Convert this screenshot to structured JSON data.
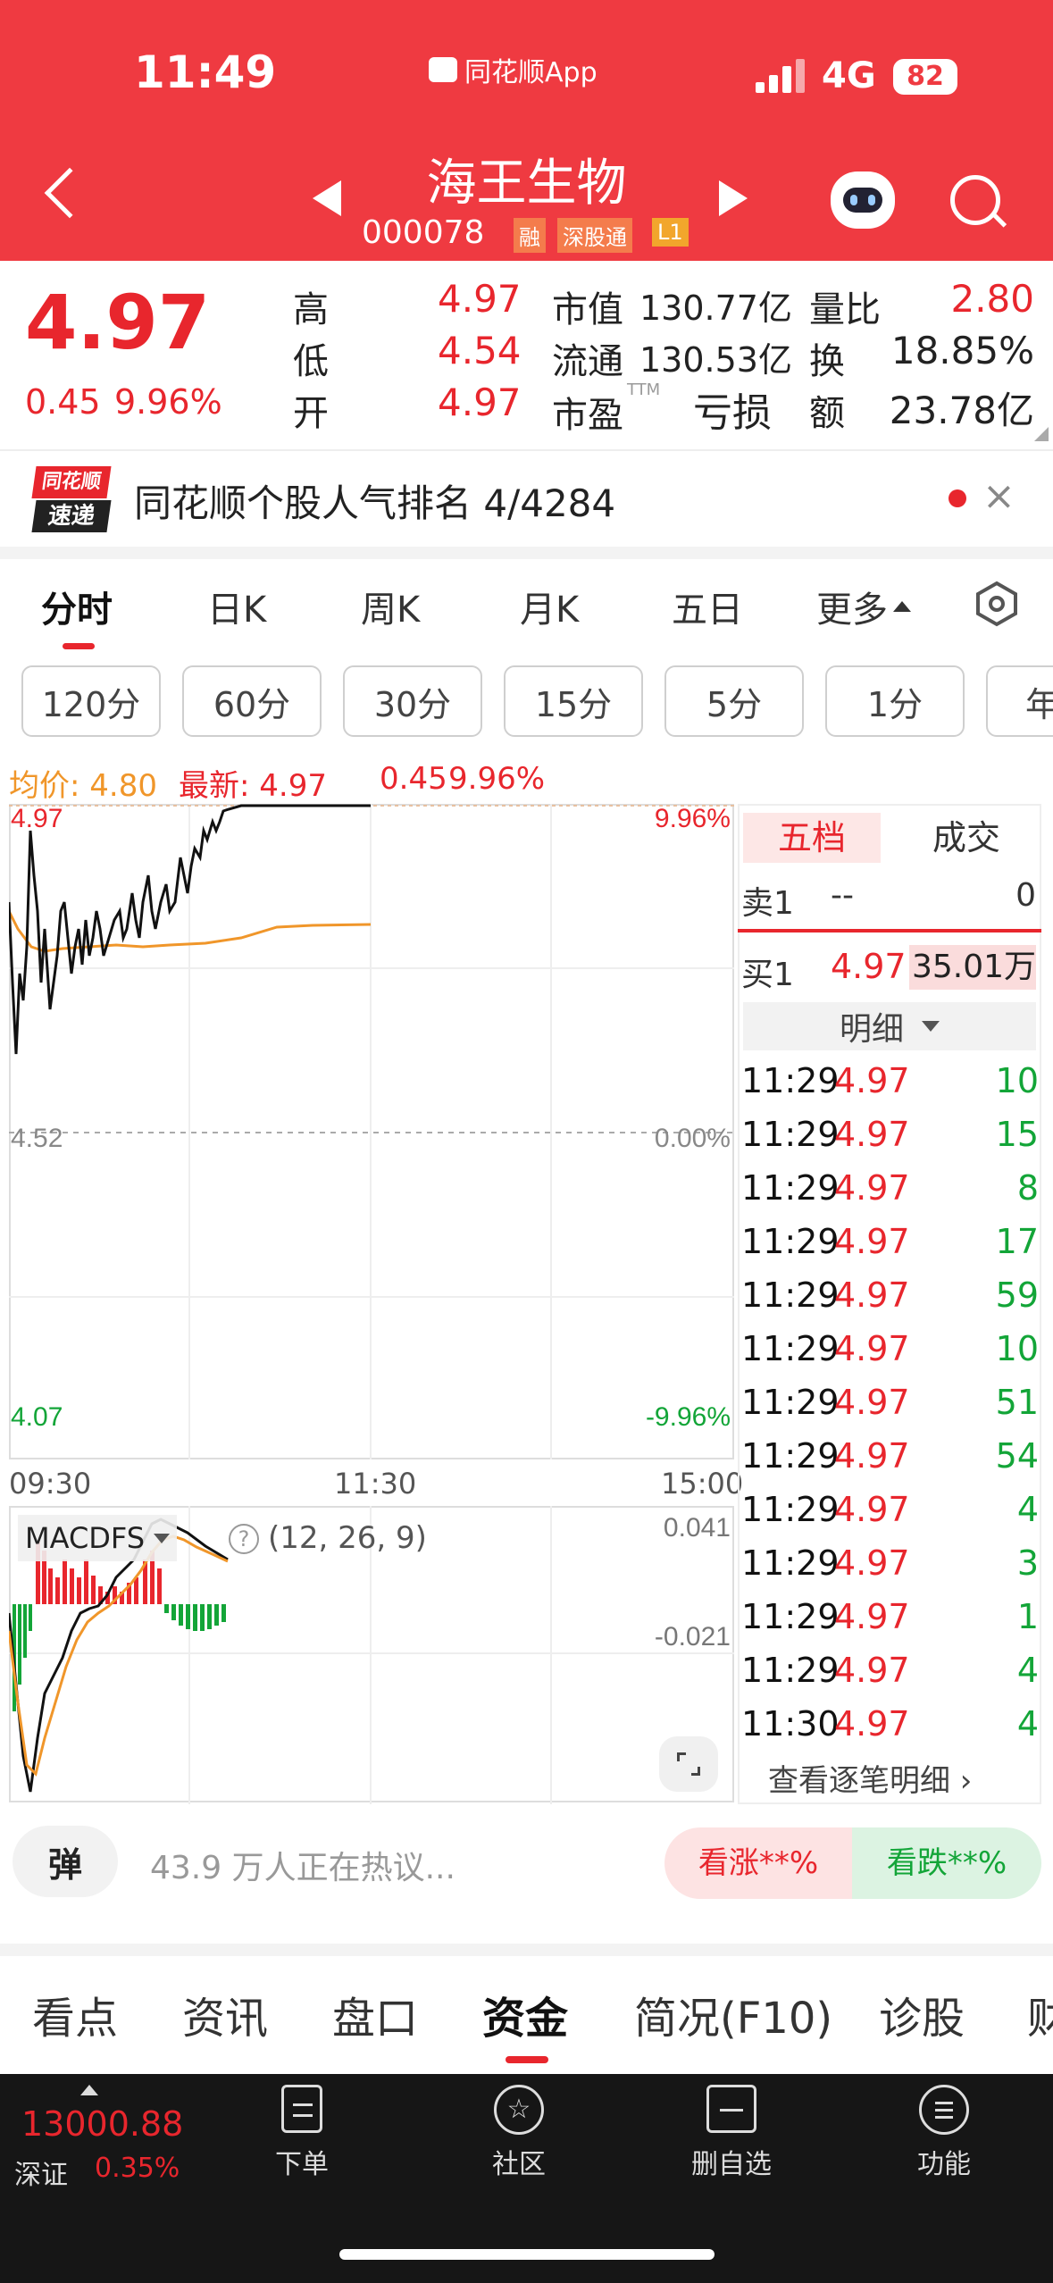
{
  "status_bar": {
    "time": "11:49",
    "app_label": "同花顺App",
    "network": "4G",
    "battery": "82"
  },
  "header": {
    "title": "海王生物",
    "code": "000078",
    "badges": [
      "融",
      "深股通",
      "L1"
    ]
  },
  "quote": {
    "price": "4.97",
    "change": "0.45",
    "change_pct": "9.96%",
    "stats": [
      {
        "label": "高",
        "value": "4.97"
      },
      {
        "label": "低",
        "value": "4.54"
      },
      {
        "label": "开",
        "value": "4.97"
      },
      {
        "label": "市值",
        "value": "130.77亿"
      },
      {
        "label": "流通",
        "value": "130.53亿"
      },
      {
        "label": "市盈",
        "sup": "TTM",
        "value": "亏损"
      },
      {
        "label": "量比",
        "value": "2.80"
      },
      {
        "label": "换",
        "value": "18.85%"
      },
      {
        "label": "额",
        "value": "23.78亿"
      }
    ]
  },
  "banner": {
    "logo_top": "同花顺",
    "logo_bottom": "速递",
    "text": "同花顺个股人气排名 4/4284"
  },
  "chart_tabs": [
    "分时",
    "日K",
    "周K",
    "月K",
    "五日",
    "更多"
  ],
  "period_buttons": [
    "120分",
    "60分",
    "30分",
    "15分",
    "5分",
    "1分",
    "年"
  ],
  "chart_info": {
    "avg_label": "均价: 4.80",
    "latest_label": "最新: 4.97",
    "change": "0.45",
    "pct": "9.96%"
  },
  "chart_axis": {
    "y_top": "4.97",
    "y_mid": "4.52",
    "y_bot": "4.07",
    "pct_top": "9.96%",
    "pct_mid": "0.00%",
    "pct_bot": "-9.96%",
    "x_start": "09:30",
    "x_mid": "11:30",
    "x_end": "15:00"
  },
  "macd": {
    "name": "MACDFS",
    "help": "?",
    "params": "(12, 26, 9)",
    "top": "0.041",
    "bot": "-0.021"
  },
  "chart_data": {
    "type": "line",
    "x": [
      "09:30",
      "09:35",
      "09:45",
      "10:00",
      "10:15",
      "10:30",
      "10:45",
      "11:00",
      "11:15",
      "11:30"
    ],
    "series": [
      {
        "name": "最新",
        "values": [
          4.75,
          4.58,
          4.85,
          4.7,
          4.74,
          4.78,
          4.82,
          4.95,
          4.97,
          4.97
        ]
      },
      {
        "name": "均价",
        "values": [
          4.75,
          4.72,
          4.74,
          4.75,
          4.76,
          4.77,
          4.78,
          4.79,
          4.8,
          4.8
        ]
      }
    ],
    "ylim": [
      4.07,
      4.97
    ]
  },
  "order_book": {
    "tab_active": "五档",
    "tab_other": "成交",
    "sell_label": "卖1",
    "sell_price": "--",
    "sell_vol": "0",
    "buy_label": "买1",
    "buy_price": "4.97",
    "buy_vol": "35.01万",
    "detail_label": "明细"
  },
  "ticks": [
    {
      "time": "11:29",
      "price": "4.97",
      "vol": "10"
    },
    {
      "time": "11:29",
      "price": "4.97",
      "vol": "15"
    },
    {
      "time": "11:29",
      "price": "4.97",
      "vol": "8"
    },
    {
      "time": "11:29",
      "price": "4.97",
      "vol": "17"
    },
    {
      "time": "11:29",
      "price": "4.97",
      "vol": "59"
    },
    {
      "time": "11:29",
      "price": "4.97",
      "vol": "10"
    },
    {
      "time": "11:29",
      "price": "4.97",
      "vol": "51"
    },
    {
      "time": "11:29",
      "price": "4.97",
      "vol": "54"
    },
    {
      "time": "11:29",
      "price": "4.97",
      "vol": "4"
    },
    {
      "time": "11:29",
      "price": "4.97",
      "vol": "3"
    },
    {
      "time": "11:29",
      "price": "4.97",
      "vol": "1"
    },
    {
      "time": "11:29",
      "price": "4.97",
      "vol": "4"
    },
    {
      "time": "11:30",
      "price": "4.97",
      "vol": "4"
    }
  ],
  "view_detail": "查看逐笔明细 ›",
  "discussion": {
    "danmu": "弹",
    "text": "43.9 万人正在热议...",
    "up": "看涨**%",
    "down": "看跌**%"
  },
  "bottom_tabs": [
    "看点",
    "资讯",
    "盘口",
    "资金",
    "简况(F10)",
    "诊股",
    "财"
  ],
  "footer": {
    "index_value": "13000.88",
    "index_name": "深证",
    "index_pct": "0.35%",
    "items": [
      "下单",
      "社区",
      "删自选",
      "功能"
    ]
  },
  "colors": {
    "header": "#ef3a41",
    "up": "#e8262d",
    "down": "#13a538",
    "avg": "#f0962a"
  }
}
